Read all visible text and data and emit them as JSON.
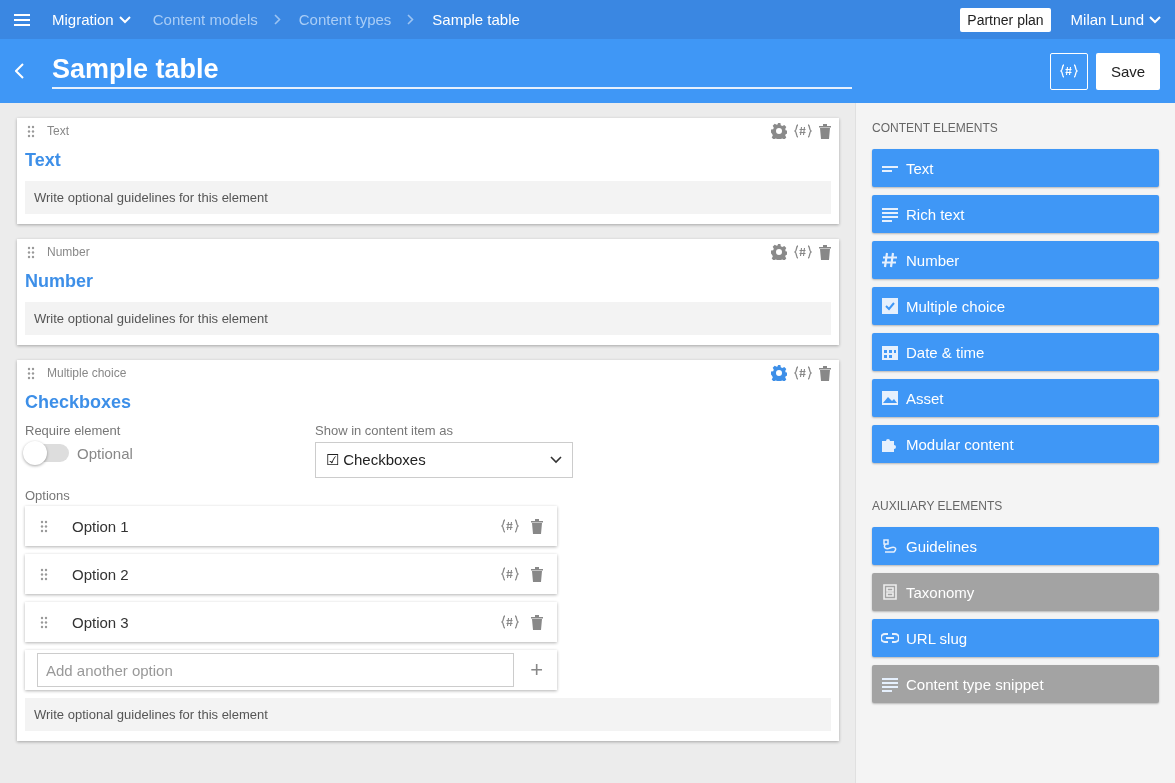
{
  "topbar": {
    "project": "Migration",
    "breadcrumbs": [
      {
        "label": "Content models",
        "current": false
      },
      {
        "label": "Content types",
        "current": false
      },
      {
        "label": "Sample table",
        "current": true
      }
    ],
    "plan": "Partner plan",
    "user": "Milan Lund"
  },
  "header": {
    "title": "Sample table",
    "save": "Save"
  },
  "elements": [
    {
      "kind": "simple",
      "type_label": "Text",
      "name": "Text",
      "settings_active": false,
      "guidelines_placeholder": "Write optional guidelines for this element"
    },
    {
      "kind": "simple",
      "type_label": "Number",
      "name": "Number",
      "settings_active": false,
      "guidelines_placeholder": "Write optional guidelines for this element"
    },
    {
      "kind": "multiple_choice",
      "type_label": "Multiple choice",
      "name": "Checkboxes",
      "settings_active": true,
      "require_label": "Require element",
      "required": false,
      "required_text": "Optional",
      "show_as_label": "Show in content item as",
      "show_as_value": "☑ Checkboxes",
      "options_label": "Options",
      "options": [
        "Option 1",
        "Option 2",
        "Option 3"
      ],
      "add_option_placeholder": "Add another option",
      "add_symbol": "+",
      "guidelines_placeholder": "Write optional guidelines for this element"
    }
  ],
  "sidebar": {
    "sections": [
      {
        "heading": "CONTENT ELEMENTS",
        "items": [
          {
            "label": "Text",
            "kind": "text",
            "disabled": false
          },
          {
            "label": "Rich text",
            "kind": "richtext",
            "disabled": false
          },
          {
            "label": "Number",
            "kind": "number",
            "disabled": false
          },
          {
            "label": "Multiple choice",
            "kind": "check",
            "disabled": false
          },
          {
            "label": "Date & time",
            "kind": "calendar",
            "disabled": false
          },
          {
            "label": "Asset",
            "kind": "image",
            "disabled": false
          },
          {
            "label": "Modular content",
            "kind": "puzzle",
            "disabled": false
          }
        ]
      },
      {
        "heading": "AUXILIARY ELEMENTS",
        "items": [
          {
            "label": "Guidelines",
            "kind": "guidelines",
            "disabled": false
          },
          {
            "label": "Taxonomy",
            "kind": "taxonomy",
            "disabled": true
          },
          {
            "label": "URL slug",
            "kind": "link",
            "disabled": false
          },
          {
            "label": "Content type snippet",
            "kind": "snippet",
            "disabled": true
          }
        ]
      }
    ]
  }
}
